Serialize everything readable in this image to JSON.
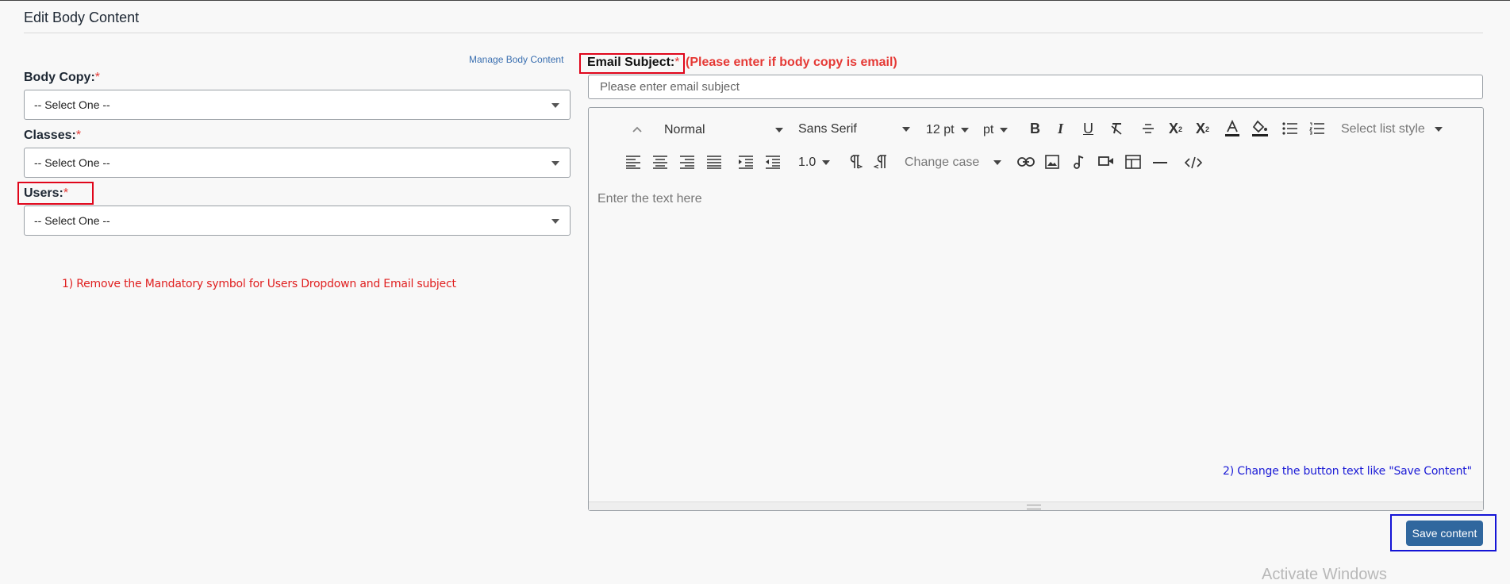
{
  "page": {
    "title": "Edit Body Content"
  },
  "manage_link": "Manage Body Content",
  "fields": {
    "body_copy": {
      "label": "Body Copy:",
      "required_mark": "*",
      "selected": "-- Select One --"
    },
    "classes": {
      "label": "Classes:",
      "required_mark": "*",
      "selected": "-- Select One --"
    },
    "users": {
      "label": "Users:",
      "required_mark": "*",
      "selected": "-- Select One --"
    }
  },
  "email": {
    "label": "Email Subject:",
    "required_mark": "*",
    "hint": "(Please enter if body copy is email)",
    "placeholder": "Please enter email subject",
    "value": ""
  },
  "toolbar": {
    "heading": "Normal",
    "font": "Sans Serif",
    "size": "12 pt",
    "unit": "pt",
    "line_height": "1.0",
    "case": "Change case",
    "list_style": "Select list style",
    "icons": [
      "collapse-icon",
      "bold-icon",
      "italic-icon",
      "underline-icon",
      "clear-format-icon",
      "strikethrough-icon",
      "superscript-icon",
      "subscript-icon",
      "font-color-icon",
      "highlight-color-icon",
      "bullet-list-icon",
      "numbered-list-icon",
      "align-left-icon",
      "align-center-icon",
      "align-right-icon",
      "align-justify-icon",
      "indent-icon",
      "outdent-icon",
      "ltr-icon",
      "rtl-icon",
      "link-icon",
      "image-icon",
      "audio-icon",
      "video-icon",
      "table-icon",
      "horizontal-rule-icon",
      "code-view-icon"
    ]
  },
  "editor": {
    "placeholder": "Enter the text here"
  },
  "notes": {
    "note1": "1) Remove the Mandatory symbol for Users Dropdown and Email subject",
    "note2": "2) Change the button text like \"Save Content\""
  },
  "save_button": "Save content",
  "watermark": "Activate Windows",
  "colors": {
    "required": "#e53935",
    "button": "#30679e",
    "annotation_red": "#e0061b",
    "annotation_blue": "#1414d6"
  }
}
